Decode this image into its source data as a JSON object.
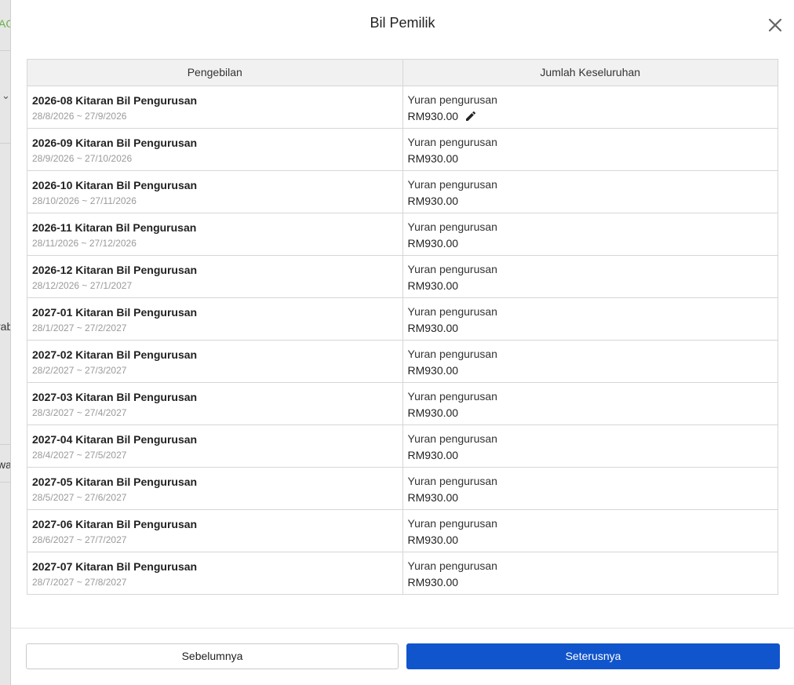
{
  "backdrop": {
    "text_top": "AG",
    "text_mid": "rab",
    "text_low": "wa",
    "chevron_icon": "chevron-down-icon"
  },
  "modal": {
    "title": "Bil Pemilik",
    "close_icon": "close-icon"
  },
  "table": {
    "headers": [
      "Pengebilan",
      "Jumlah Keseluruhan"
    ],
    "rows": [
      {
        "cycle": "2026-08 Kitaran Bil Pengurusan",
        "range": "28/8/2026 ~ 27/9/2026",
        "fee_label": "Yuran pengurusan",
        "amount": "RM930.00",
        "editable": true
      },
      {
        "cycle": "2026-09 Kitaran Bil Pengurusan",
        "range": "28/9/2026 ~ 27/10/2026",
        "fee_label": "Yuran pengurusan",
        "amount": "RM930.00"
      },
      {
        "cycle": "2026-10 Kitaran Bil Pengurusan",
        "range": "28/10/2026 ~ 27/11/2026",
        "fee_label": "Yuran pengurusan",
        "amount": "RM930.00"
      },
      {
        "cycle": "2026-11 Kitaran Bil Pengurusan",
        "range": "28/11/2026 ~ 27/12/2026",
        "fee_label": "Yuran pengurusan",
        "amount": "RM930.00"
      },
      {
        "cycle": "2026-12 Kitaran Bil Pengurusan",
        "range": "28/12/2026 ~ 27/1/2027",
        "fee_label": "Yuran pengurusan",
        "amount": "RM930.00"
      },
      {
        "cycle": "2027-01 Kitaran Bil Pengurusan",
        "range": "28/1/2027 ~ 27/2/2027",
        "fee_label": "Yuran pengurusan",
        "amount": "RM930.00"
      },
      {
        "cycle": "2027-02 Kitaran Bil Pengurusan",
        "range": "28/2/2027 ~ 27/3/2027",
        "fee_label": "Yuran pengurusan",
        "amount": "RM930.00"
      },
      {
        "cycle": "2027-03 Kitaran Bil Pengurusan",
        "range": "28/3/2027 ~ 27/4/2027",
        "fee_label": "Yuran pengurusan",
        "amount": "RM930.00"
      },
      {
        "cycle": "2027-04 Kitaran Bil Pengurusan",
        "range": "28/4/2027 ~ 27/5/2027",
        "fee_label": "Yuran pengurusan",
        "amount": "RM930.00"
      },
      {
        "cycle": "2027-05 Kitaran Bil Pengurusan",
        "range": "28/5/2027 ~ 27/6/2027",
        "fee_label": "Yuran pengurusan",
        "amount": "RM930.00"
      },
      {
        "cycle": "2027-06 Kitaran Bil Pengurusan",
        "range": "28/6/2027 ~ 27/7/2027",
        "fee_label": "Yuran pengurusan",
        "amount": "RM930.00"
      },
      {
        "cycle": "2027-07 Kitaran Bil Pengurusan",
        "range": "28/7/2027 ~ 27/8/2027",
        "fee_label": "Yuran pengurusan",
        "amount": "RM930.00"
      }
    ],
    "edit_icon": "pencil-icon"
  },
  "footer": {
    "prev_label": "Sebelumnya",
    "next_label": "Seterusnya"
  },
  "colors": {
    "primary": "#1155cc",
    "accent_green": "#6ab04c",
    "muted_text": "#9a9a9a"
  }
}
